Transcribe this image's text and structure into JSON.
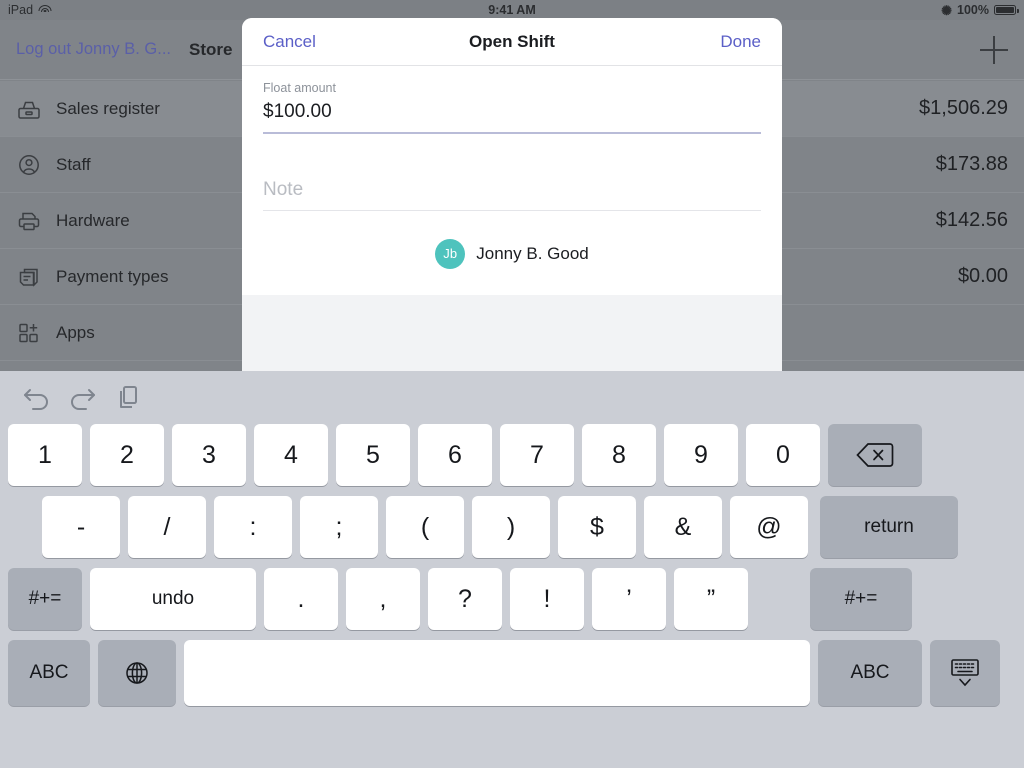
{
  "status_bar": {
    "device": "iPad",
    "wifi_icon": "wifi-icon",
    "time": "9:41 AM",
    "bluetooth_icon": "bluetooth-icon",
    "battery_percent": "100%",
    "battery_icon": "battery-full-icon"
  },
  "nav_bar": {
    "logout_label": "Log out Jonny B. G...",
    "store_label": "Store",
    "add_icon": "plus-icon"
  },
  "rows": [
    {
      "icon": "sales-register-icon",
      "label": "Sales register",
      "amount": "$1,506.29",
      "selected": true
    },
    {
      "icon": "staff-icon",
      "label": "Staff",
      "amount": "$173.88",
      "selected": false
    },
    {
      "icon": "hardware-icon",
      "label": "Hardware",
      "amount": "$142.56",
      "selected": false
    },
    {
      "icon": "payment-types-icon",
      "label": "Payment types",
      "amount": "$0.00",
      "selected": false
    },
    {
      "icon": "apps-icon",
      "label": "Apps",
      "amount": "",
      "selected": false
    }
  ],
  "modal": {
    "cancel_label": "Cancel",
    "title": "Open Shift",
    "done_label": "Done",
    "float_field": {
      "label": "Float amount",
      "value": "$100.00"
    },
    "note_field": {
      "placeholder": "Note",
      "value": ""
    },
    "user": {
      "initials": "Jb",
      "name": "Jonny B. Good",
      "avatar_color": "#4ec3bd"
    }
  },
  "keyboard": {
    "toolbar": {
      "undo_icon": "undo-icon",
      "redo_icon": "redo-icon",
      "paste_icon": "paste-icon"
    },
    "row1": [
      "1",
      "2",
      "3",
      "4",
      "5",
      "6",
      "7",
      "8",
      "9",
      "0"
    ],
    "row1_backspace_icon": "backspace-icon",
    "row2": [
      "-",
      "/",
      ":",
      ";",
      "(",
      ")",
      "$",
      "&",
      "@"
    ],
    "row2_return": "return",
    "row3_symbols_left": "#+=",
    "row3": [
      "undo",
      ".",
      ",",
      "?",
      "!",
      "’",
      "”"
    ],
    "row3_symbols_right": "#+=",
    "row4": {
      "abc_left": "ABC",
      "globe_icon": "globe-icon",
      "space": "",
      "abc_right": "ABC",
      "dismiss_icon": "dismiss-keyboard-icon"
    }
  },
  "colors": {
    "accent_blue": "#5b5fc7",
    "teal": "#4ec3bd",
    "keyboard_bg": "#cbced5",
    "backdrop": "#808489"
  }
}
